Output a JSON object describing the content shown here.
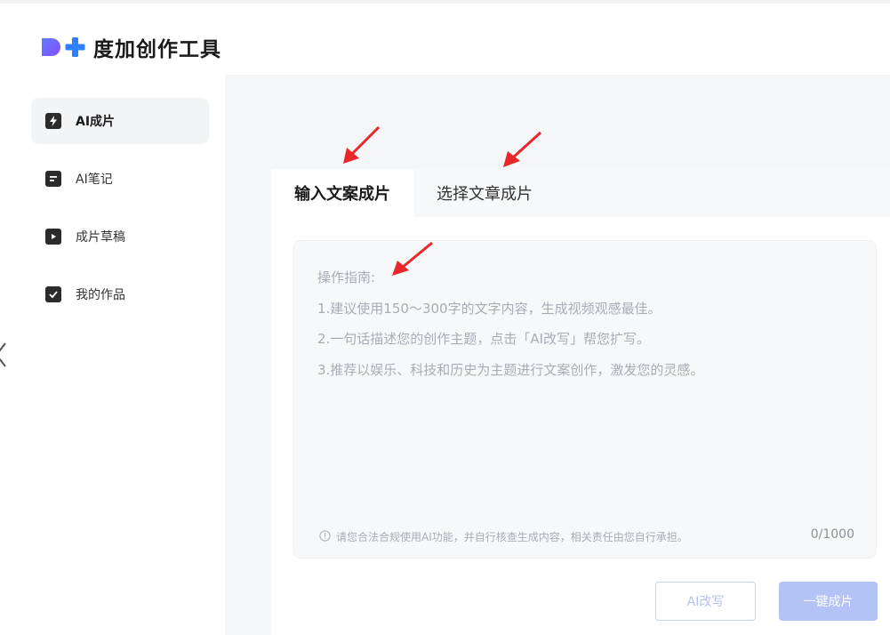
{
  "app": {
    "title": "度加创作工具",
    "logo_icon": "d-plus-logo-icon"
  },
  "sidebar": {
    "items": [
      {
        "label": "AI成片",
        "icon": "lightning-icon",
        "active": true
      },
      {
        "label": "AI笔记",
        "icon": "note-icon",
        "active": false
      },
      {
        "label": "成片草稿",
        "icon": "video-draft-icon",
        "active": false
      },
      {
        "label": "我的作品",
        "icon": "checked-folder-icon",
        "active": false
      }
    ],
    "collapse_icon": "chevron-left-icon"
  },
  "tabs": [
    {
      "label": "输入文案成片",
      "active": true
    },
    {
      "label": "选择文章成片",
      "active": false
    }
  ],
  "editor": {
    "guide_title": "操作指南:",
    "guide_lines": [
      "1.建议使用150～300字的文字内容，生成视频观感最佳。",
      "2.一句话描述您的创作主题，点击「AI改写」帮您扩写。",
      "3.推荐以娱乐、科技和历史为主题进行文案创作，激发您的灵感。"
    ],
    "disclaimer": "请您合法合规使用AI功能，并自行核查生成内容，相关责任由您自行承担。",
    "disclaimer_icon": "info-circle-icon",
    "char_count": "0/1000"
  },
  "actions": {
    "rewrite_label": "AI改写",
    "generate_label": "一键成片"
  },
  "annotations": {
    "arrow_color": "#e8262b"
  },
  "colors": {
    "accent": "#4e6ef2",
    "button_disabled": "#b3c3f6"
  }
}
